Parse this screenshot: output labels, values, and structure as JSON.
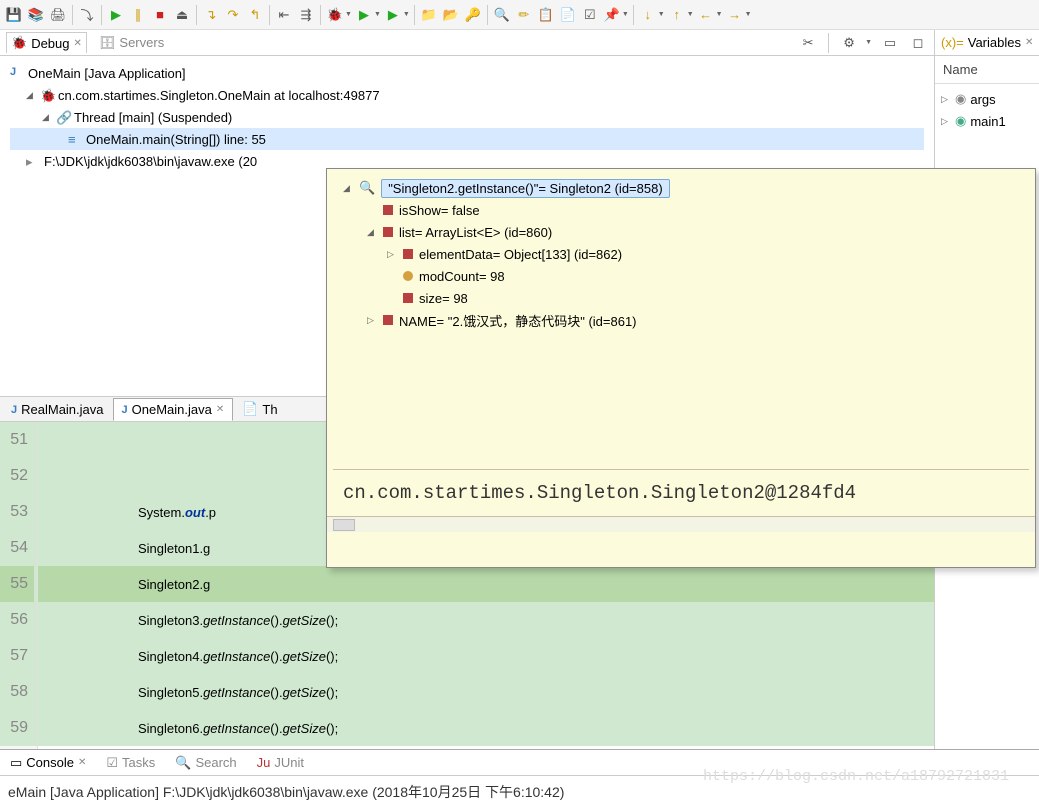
{
  "toolbar_icons": [
    "save",
    "save-all",
    "print",
    "skip",
    "run",
    "pause",
    "stop",
    "disconnect",
    "step-into",
    "step-over",
    "step-return",
    "drop-frame",
    "use-step-filters",
    "resume",
    "suspend",
    "terminate",
    "debug",
    "debug-last",
    "run-last",
    "new",
    "open",
    "pin",
    "search",
    "highlight",
    "toggle-bp",
    "outline",
    "expressions",
    "next",
    "back-nav",
    "fwd-nav"
  ],
  "debug": {
    "tab_label": "Debug",
    "servers_label": "Servers",
    "tree": {
      "launch": "OneMain [Java Application]",
      "target": "cn.com.startimes.Singleton.OneMain at localhost:49877",
      "thread": "Thread [main] (Suspended)",
      "frame": "OneMain.main(String[]) line: 55",
      "process": "F:\\JDK\\jdk\\jdk6038\\bin\\javaw.exe (20"
    }
  },
  "popup": {
    "root": "\"Singleton2.getInstance()\"= Singleton2  (id=858)",
    "fields": [
      {
        "indent": 1,
        "name": "isShow= false",
        "icon": "field"
      },
      {
        "indent": 1,
        "name": "list= ArrayList<E>  (id=860)",
        "icon": "field",
        "expanded": true
      },
      {
        "indent": 2,
        "name": "elementData= Object[133]  (id=862)",
        "icon": "field",
        "hasChildren": true
      },
      {
        "indent": 2,
        "name": "modCount= 98",
        "icon": "final"
      },
      {
        "indent": 2,
        "name": "size= 98",
        "icon": "field"
      },
      {
        "indent": 1,
        "name": "NAME= \"2.饿汉式，静态代码块\" (id=861)",
        "icon": "static",
        "hasChildren": true
      }
    ],
    "value": "cn.com.startimes.Singleton.Singleton2@1284fd4"
  },
  "editor": {
    "tabs": [
      {
        "label": "RealMain.java",
        "active": false
      },
      {
        "label": "OneMain.java",
        "active": true
      },
      {
        "label": "Th",
        "active": false
      }
    ],
    "lines": [
      {
        "n": "51",
        "txt": ""
      },
      {
        "n": "52",
        "txt": ""
      },
      {
        "n": "53",
        "txt_pre": "System.",
        "field": "out",
        "txt_post": ".p"
      },
      {
        "n": "54",
        "txt": "Singleton1.g"
      },
      {
        "n": "55",
        "txt": "Singleton2.g",
        "current": true
      },
      {
        "n": "56",
        "call": "Singleton3"
      },
      {
        "n": "57",
        "call": "Singleton4"
      },
      {
        "n": "58",
        "call": "Singleton5"
      },
      {
        "n": "59",
        "call": "Singleton6"
      }
    ],
    "method_call_pre": ".",
    "method_getInstance": "getInstance",
    "method_mid": "().",
    "method_getSize": "getSize",
    "method_post": "();"
  },
  "variables": {
    "header": "Variables",
    "name_col": "Name",
    "items": [
      {
        "label": "args",
        "icon": "param"
      },
      {
        "label": "main1",
        "icon": "local"
      }
    ]
  },
  "console": {
    "tabs": [
      "Console",
      "Tasks",
      "Search",
      "JUnit"
    ],
    "status": "eMain [Java Application] F:\\JDK\\jdk\\jdk6038\\bin\\javaw.exe (2018年10月25日 下午6:10:42)"
  },
  "watermark": "https://blog.csdn.net/a18792721831"
}
